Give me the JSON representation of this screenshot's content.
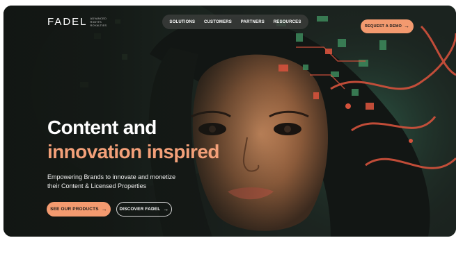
{
  "header": {
    "logo_text": "FADEL",
    "logo_tagline": [
      "ADVANCED",
      "RIGHTS",
      "ROYALTIES"
    ],
    "nav": [
      "SOLUTIONS",
      "CUSTOMERS",
      "PARTNERS",
      "RESOURCES"
    ],
    "cta_label": "REQUEST A DEMO"
  },
  "hero": {
    "title_line1": "Content and",
    "title_line2": "innovation inspired",
    "subtitle_line1": "Empowering Brands to innovate and monetize",
    "subtitle_line2": "their Content & Licensed Properties",
    "primary_button": "SEE OUR PRODUCTS",
    "secondary_button": "DISCOVER FADEL"
  },
  "icons": {
    "arrow": "→"
  },
  "colors": {
    "accent": "#f39a6f",
    "title_highlight": "#f3a079",
    "background": "#1c211d"
  }
}
